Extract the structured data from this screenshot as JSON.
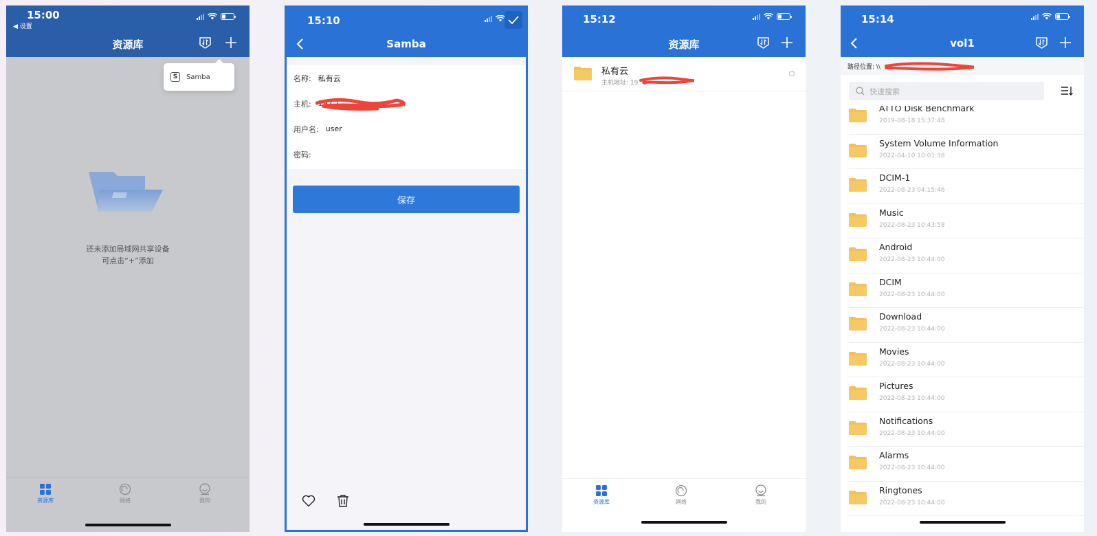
{
  "phone1": {
    "status_time": "15:00",
    "status_back": "◀ 设置",
    "title": "资源库",
    "popup_item": "Samba",
    "popup_badge": "S",
    "empty_line1": "还未添加局域网共享设备",
    "empty_line2": "可点击“+”添加",
    "tabs": [
      "资源库",
      "网络",
      "我的"
    ]
  },
  "phone2": {
    "status_time": "15:10",
    "title": "Samba",
    "fields": [
      {
        "label": "名称:",
        "value": "私有云"
      },
      {
        "label": "主机:",
        "value": "192.1"
      },
      {
        "label": "用户名:",
        "value": "user"
      },
      {
        "label": "密码:",
        "value": ""
      }
    ],
    "save_label": "保存"
  },
  "phone3": {
    "status_time": "15:12",
    "title": "资源库",
    "server_name": "私有云",
    "server_sub": "主机地址: 19",
    "tabs": [
      "资源库",
      "网络",
      "我的"
    ]
  },
  "phone4": {
    "status_time": "15:14",
    "title": "vol1",
    "path_label": "路径位置: \\\\",
    "search_placeholder": "快速搜索",
    "items": [
      {
        "name": "ATTO Disk Benchmark",
        "date": "2019-08-18 15:37:48"
      },
      {
        "name": "System Volume Information",
        "date": "2022-04-10 10:01:38"
      },
      {
        "name": "DCIM-1",
        "date": "2022-08-23 04:15:46"
      },
      {
        "name": "Music",
        "date": "2022-08-23 10:43:58"
      },
      {
        "name": "Android",
        "date": "2022-08-23 10:44:00"
      },
      {
        "name": "DCIM",
        "date": "2022-08-23 10:44:00"
      },
      {
        "name": "Download",
        "date": "2022-08-23 10:44:00"
      },
      {
        "name": "Movies",
        "date": "2022-08-23 10:44:00"
      },
      {
        "name": "Pictures",
        "date": "2022-08-23 10:44:00"
      },
      {
        "name": "Notifications",
        "date": "2022-08-23 10:44:00"
      },
      {
        "name": "Alarms",
        "date": "2022-08-23 10:44:00"
      },
      {
        "name": "Ringtones",
        "date": "2022-08-23 10:44:00"
      }
    ]
  },
  "colors": {
    "primary": "#2b72d6",
    "folder": "#f4c05a",
    "redaction": "#f0443a"
  }
}
